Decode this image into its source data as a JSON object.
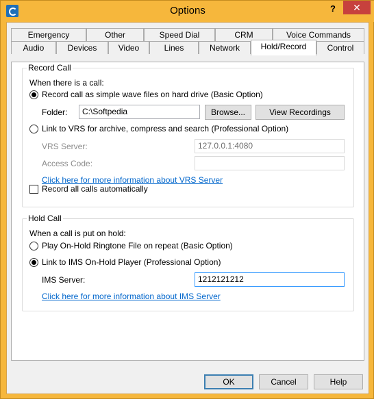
{
  "window": {
    "title": "Options",
    "help_label": "?",
    "close_label": "✕"
  },
  "tabs": {
    "back_row": [
      "Emergency",
      "Other",
      "Speed Dial",
      "CRM",
      "Voice Commands"
    ],
    "front_row": [
      "Audio",
      "Devices",
      "Video",
      "Lines",
      "Network",
      "Hold/Record",
      "Control"
    ],
    "active": "Hold/Record"
  },
  "record_call": {
    "group_title": "Record Call",
    "when_label": "When there is a call:",
    "option_wave": "Record call as simple wave files on hard drive (Basic Option)",
    "folder_label": "Folder:",
    "folder_value": "C:\\Softpedia",
    "browse_button": "Browse...",
    "view_recordings_button": "View Recordings",
    "option_vrs": "Link to VRS for archive, compress and search (Professional Option)",
    "vrs_server_label": "VRS Server:",
    "vrs_server_value": "127.0.0.1:4080",
    "access_code_label": "Access Code:",
    "access_code_value": "",
    "vrs_link": "Click here for more information about VRS Server",
    "record_all_label": "Record all calls automatically",
    "selected_option": "wave"
  },
  "hold_call": {
    "group_title": "Hold Call",
    "when_label": "When a call is put on hold:",
    "option_ringtone": "Play On-Hold Ringtone File on repeat (Basic Option)",
    "option_ims": "Link to IMS On-Hold Player (Professional Option)",
    "ims_server_label": "IMS Server:",
    "ims_server_value": "1212121212",
    "ims_link": "Click here for more information about IMS Server",
    "selected_option": "ims"
  },
  "footer": {
    "ok_button": "OK",
    "cancel_button": "Cancel",
    "help_button": "Help"
  }
}
